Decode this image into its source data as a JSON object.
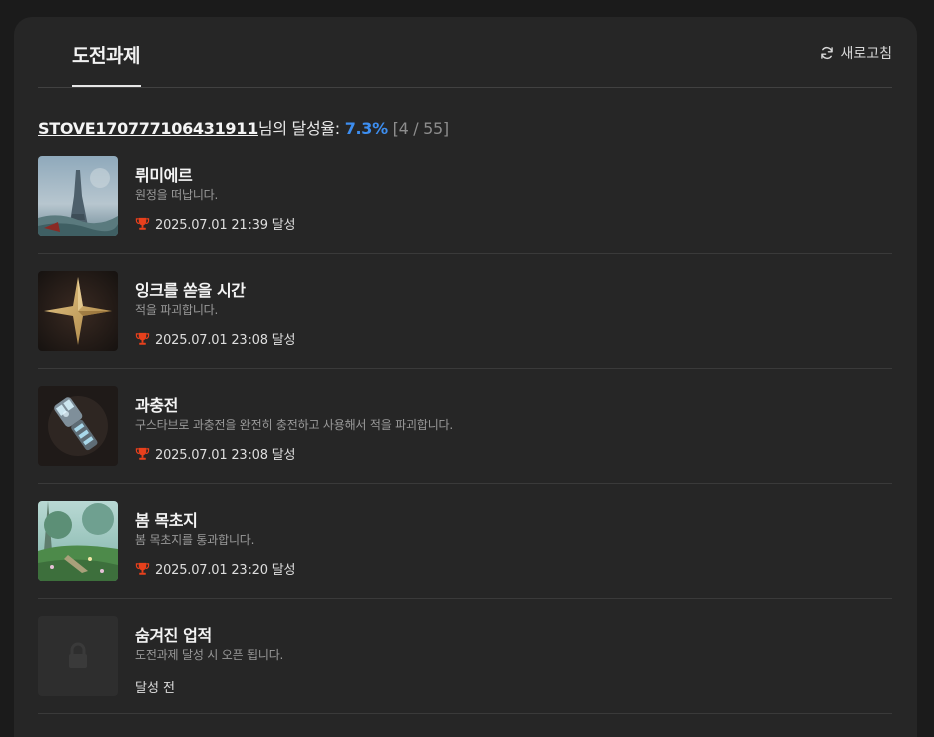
{
  "header": {
    "tab_label": "도전과제",
    "refresh_label": "새로고침"
  },
  "summary": {
    "user": "STOVE170777106431911",
    "suffix": "님의 달성율: ",
    "rate": "7.3%",
    "count": " [4 / 55]"
  },
  "achievements": [
    {
      "title": "뤼미에르",
      "desc": "원정을 떠납니다.",
      "date": "2025.07.01 21:39 달성",
      "icon": "tower-landscape-icon"
    },
    {
      "title": "잉크를 쏟을 시간",
      "desc": "적을 파괴합니다.",
      "date": "2025.07.01 23:08 달성",
      "icon": "star-icon"
    },
    {
      "title": "과충전",
      "desc": "구스타브로 과충전을 완전히 충전하고 사용해서 적을 파괴합니다.",
      "date": "2025.07.01 23:08 달성",
      "icon": "gauntlet-icon"
    },
    {
      "title": "봄 목초지",
      "desc": "봄 목초지를 통과합니다.",
      "date": "2025.07.01 23:20 달성",
      "icon": "meadow-landscape-icon"
    },
    {
      "title": "숨겨진 업적",
      "desc": "도전과제 달성 시 오픈 됩니다.",
      "status": "달성 전",
      "icon": "lock-icon"
    }
  ],
  "colors": {
    "accent": "#3d8ef0",
    "trophy": "#e8401c",
    "panel": "#262626",
    "background": "#1b1b1b"
  }
}
